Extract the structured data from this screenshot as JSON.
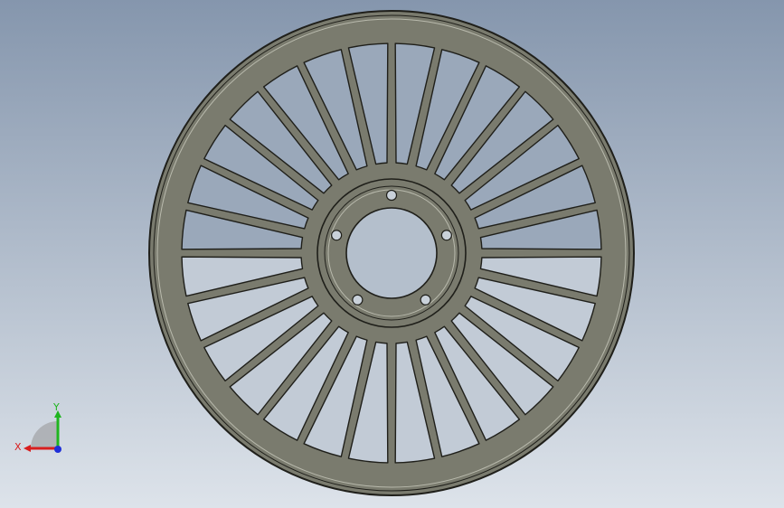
{
  "viewport": {
    "background_top": "#8596ad",
    "background_bottom": "#dde3ea"
  },
  "model": {
    "part": "spoked-wheel",
    "spoke_count": 28,
    "bolt_hole_count": 5,
    "fill_color": "#7a7b6e",
    "edge_color": "#1f1f1a",
    "highlight_color": "#b9baad"
  },
  "triad": {
    "x_label": "X",
    "y_label": "Y",
    "x_color": "#d81e1e",
    "y_color": "#1fb51f",
    "z_color": "#1e2fd8"
  }
}
